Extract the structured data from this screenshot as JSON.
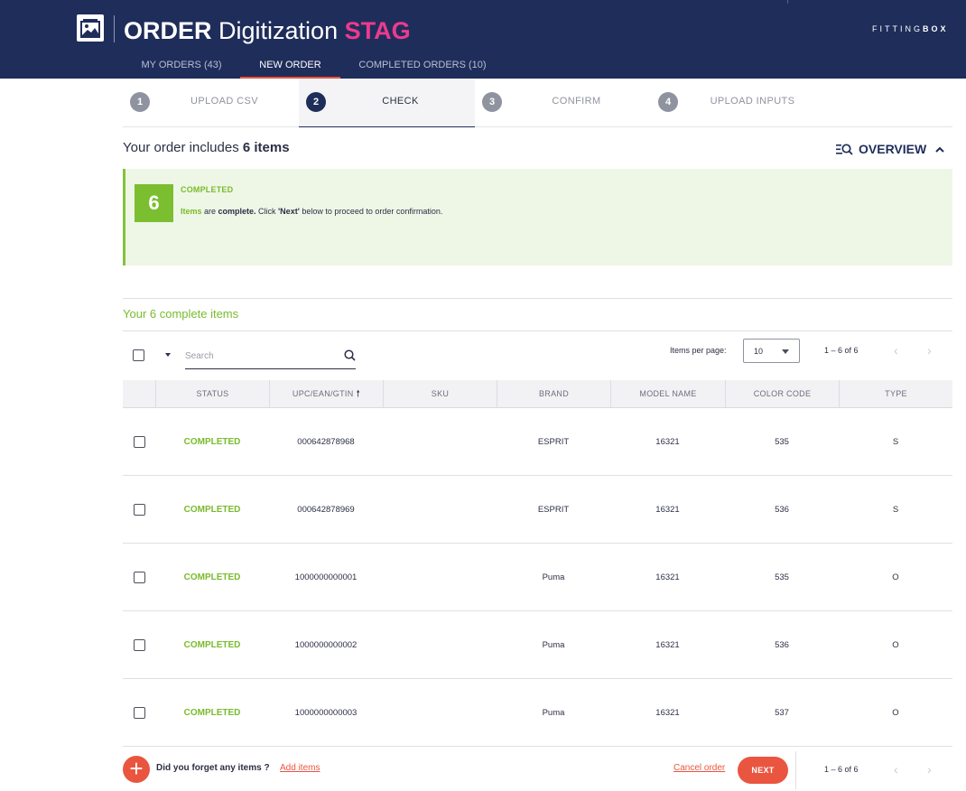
{
  "header": {
    "title_part1": "ORDER",
    "title_part2": "Digitization",
    "title_part3": "STAG",
    "brand_part1": "FITTING",
    "brand_part2": "BOX",
    "colors": {
      "background": "#1f2d5a",
      "stag": "#ec3a8f",
      "accent": "#e8553f"
    }
  },
  "nav": {
    "tabs": [
      {
        "label": "MY ORDERS (43)",
        "active": false
      },
      {
        "label": "NEW ORDER",
        "active": true
      },
      {
        "label": "COMPLETED ORDERS (10)",
        "active": false
      }
    ]
  },
  "stepper": {
    "steps": [
      {
        "num": "1",
        "label": "UPLOAD CSV",
        "active": false
      },
      {
        "num": "2",
        "label": "CHECK",
        "active": true
      },
      {
        "num": "3",
        "label": "CONFIRM",
        "active": false
      },
      {
        "num": "4",
        "label": "UPLOAD INPUTS",
        "active": false
      }
    ]
  },
  "summary": {
    "prefix": "Your order includes ",
    "count": "6 items",
    "overview_label": "OVERVIEW"
  },
  "status_card": {
    "count": "6",
    "status": "COMPLETED",
    "desc_items": "Items",
    "desc_are": " are ",
    "desc_complete": "complete.",
    "desc_click": " Click ",
    "desc_next": "'Next'",
    "desc_rest": " below to proceed to order confirmation.",
    "color": "#7bbf30"
  },
  "complete_section": {
    "title": "Your 6 complete items"
  },
  "toolbar": {
    "search_placeholder": "Search",
    "items_per_page_label": "Items per page:",
    "items_per_page_value": "10",
    "range": "1 – 6 of 6"
  },
  "table": {
    "columns": [
      "STATUS",
      "UPC/EAN/GTIN",
      "SKU",
      "BRAND",
      "MODEL NAME",
      "COLOR CODE",
      "TYPE"
    ],
    "rows": [
      {
        "status": "COMPLETED",
        "upc": "000642878968",
        "sku": "",
        "brand": "ESPRIT",
        "model": "16321",
        "color": "535",
        "type": "S"
      },
      {
        "status": "COMPLETED",
        "upc": "000642878969",
        "sku": "",
        "brand": "ESPRIT",
        "model": "16321",
        "color": "536",
        "type": "S"
      },
      {
        "status": "COMPLETED",
        "upc": "1000000000001",
        "sku": "",
        "brand": "Puma",
        "model": "16321",
        "color": "535",
        "type": "O"
      },
      {
        "status": "COMPLETED",
        "upc": "1000000000002",
        "sku": "",
        "brand": "Puma",
        "model": "16321",
        "color": "536",
        "type": "O"
      },
      {
        "status": "COMPLETED",
        "upc": "1000000000003",
        "sku": "",
        "brand": "Puma",
        "model": "16321",
        "color": "537",
        "type": "O"
      }
    ]
  },
  "footer": {
    "forget_text": "Did you forget any items ?",
    "add_items_label": "Add items",
    "cancel_label": "Cancel order",
    "next_label": "NEXT",
    "range": "1 – 6 of 6"
  }
}
